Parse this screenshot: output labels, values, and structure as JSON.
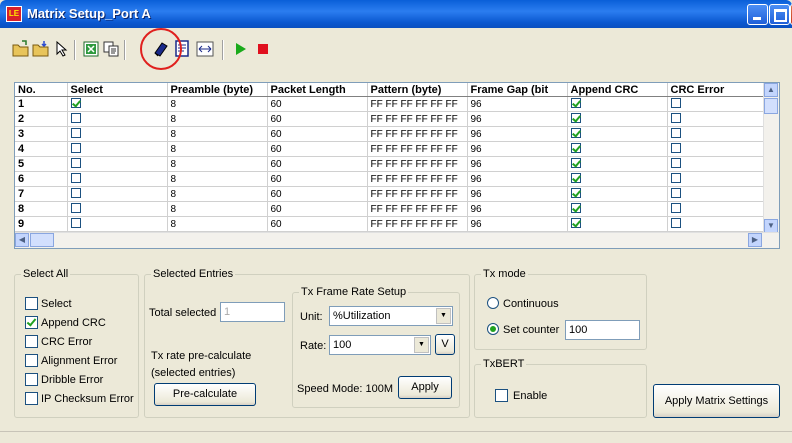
{
  "window": {
    "title": "Matrix Setup_Port A",
    "icon_label": "LE",
    "controls": [
      "minimize-icon",
      "maximize-icon",
      "close-icon"
    ]
  },
  "toolbar": {
    "icons": [
      "open-folder-icon",
      "save-folder-icon",
      "pointer-icon",
      "excel-export-icon",
      "copy-icon",
      "eraser-icon",
      "edit-icon",
      "fit-width-icon",
      "play-icon",
      "stop-icon"
    ],
    "highlighted": "eraser-icon"
  },
  "grid": {
    "columns": [
      "No.",
      "Select",
      "Preamble (byte)",
      "Packet Length",
      "Pattern (byte)",
      "Frame Gap (bit",
      "Append CRC",
      "CRC Error"
    ],
    "rows": [
      {
        "no": "1",
        "select": true,
        "preamble": "8",
        "length": "60",
        "pattern": "FF FF FF FF FF FF",
        "gap": "96",
        "append_crc": true,
        "crc_error": false
      },
      {
        "no": "2",
        "select": false,
        "preamble": "8",
        "length": "60",
        "pattern": "FF FF FF FF FF FF",
        "gap": "96",
        "append_crc": true,
        "crc_error": false
      },
      {
        "no": "3",
        "select": false,
        "preamble": "8",
        "length": "60",
        "pattern": "FF FF FF FF FF FF",
        "gap": "96",
        "append_crc": true,
        "crc_error": false
      },
      {
        "no": "4",
        "select": false,
        "preamble": "8",
        "length": "60",
        "pattern": "FF FF FF FF FF FF",
        "gap": "96",
        "append_crc": true,
        "crc_error": false
      },
      {
        "no": "5",
        "select": false,
        "preamble": "8",
        "length": "60",
        "pattern": "FF FF FF FF FF FF",
        "gap": "96",
        "append_crc": true,
        "crc_error": false
      },
      {
        "no": "6",
        "select": false,
        "preamble": "8",
        "length": "60",
        "pattern": "FF FF FF FF FF FF",
        "gap": "96",
        "append_crc": true,
        "crc_error": false
      },
      {
        "no": "7",
        "select": false,
        "preamble": "8",
        "length": "60",
        "pattern": "FF FF FF FF FF FF",
        "gap": "96",
        "append_crc": true,
        "crc_error": false
      },
      {
        "no": "8",
        "select": false,
        "preamble": "8",
        "length": "60",
        "pattern": "FF FF FF FF FF FF",
        "gap": "96",
        "append_crc": true,
        "crc_error": false
      },
      {
        "no": "9",
        "select": false,
        "preamble": "8",
        "length": "60",
        "pattern": "FF FF FF FF FF FF",
        "gap": "96",
        "append_crc": true,
        "crc_error": false
      }
    ]
  },
  "select_all": {
    "title": "Select All",
    "items": [
      {
        "label": "Select",
        "checked": false
      },
      {
        "label": "Append CRC",
        "checked": true
      },
      {
        "label": "CRC Error",
        "checked": false
      },
      {
        "label": "Alignment Error",
        "checked": false
      },
      {
        "label": "Dribble Error",
        "checked": false
      },
      {
        "label": "IP Checksum Error",
        "checked": false
      }
    ]
  },
  "selected_entries": {
    "title": "Selected Entries",
    "total_label": "Total selected",
    "total_value": "1",
    "precalc_line1": "Tx rate pre-calculate",
    "precalc_line2": "(selected entries)",
    "precalc_button": "Pre-calculate"
  },
  "tx_frame": {
    "title": "Tx Frame Rate Setup",
    "unit_label": "Unit:",
    "unit_value": "%Utilization",
    "rate_label": "Rate:",
    "rate_value": "100",
    "v_button": "V",
    "speed_mode": "Speed Mode: 100M",
    "apply_button": "Apply"
  },
  "tx_mode": {
    "title": "Tx mode",
    "continuous": "Continuous",
    "set_counter": "Set counter",
    "counter_value": "100",
    "selected": "set_counter"
  },
  "txbert": {
    "title": "TxBERT",
    "enable": "Enable",
    "checked": false
  },
  "apply_matrix_button": "Apply Matrix Settings"
}
